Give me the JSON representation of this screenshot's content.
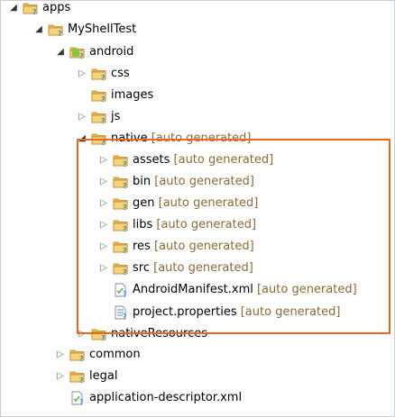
{
  "tree": {
    "suffix": "[auto generated]",
    "items": [
      {
        "label": "apps",
        "icon": "project-folder-icon",
        "expanded": true,
        "suffix": false
      },
      {
        "label": "MyShellTest",
        "icon": "project-folder-icon",
        "expanded": true,
        "suffix": false
      },
      {
        "label": "android",
        "icon": "android-folder-icon",
        "expanded": true,
        "suffix": false
      },
      {
        "label": "css",
        "icon": "folder-icon",
        "expanded": false,
        "suffix": false
      },
      {
        "label": "images",
        "icon": "folder-icon",
        "expanded": null,
        "suffix": false
      },
      {
        "label": "js",
        "icon": "folder-icon",
        "expanded": false,
        "suffix": false
      },
      {
        "label": "native",
        "icon": "project-folder-icon",
        "expanded": true,
        "suffix": true
      },
      {
        "label": "assets",
        "icon": "folder-icon",
        "expanded": false,
        "suffix": true
      },
      {
        "label": "bin",
        "icon": "folder-icon",
        "expanded": false,
        "suffix": true
      },
      {
        "label": "gen",
        "icon": "folder-icon",
        "expanded": false,
        "suffix": true
      },
      {
        "label": "libs",
        "icon": "folder-icon",
        "expanded": false,
        "suffix": true
      },
      {
        "label": "res",
        "icon": "project-folder-icon",
        "expanded": false,
        "suffix": true
      },
      {
        "label": "src",
        "icon": "folder-icon",
        "expanded": false,
        "suffix": true
      },
      {
        "label": "AndroidManifest.xml",
        "icon": "xml-file-icon",
        "expanded": null,
        "suffix": true
      },
      {
        "label": "project.properties",
        "icon": "properties-file-icon",
        "expanded": null,
        "suffix": true
      },
      {
        "label": "nativeResources",
        "icon": "folder-icon",
        "expanded": false,
        "suffix": false
      },
      {
        "label": "common",
        "icon": "folder-icon",
        "expanded": false,
        "suffix": false
      },
      {
        "label": "legal",
        "icon": "folder-icon",
        "expanded": false,
        "suffix": false
      },
      {
        "label": "application-descriptor.xml",
        "icon": "xml-file-icon",
        "expanded": null,
        "suffix": false
      }
    ]
  },
  "colors": {
    "highlight_border": "#e46a22",
    "folder": "#e8b84a",
    "badge": "#3a8fd6",
    "android": "#8cc63f",
    "suffix_text": "#8a6a3a"
  }
}
